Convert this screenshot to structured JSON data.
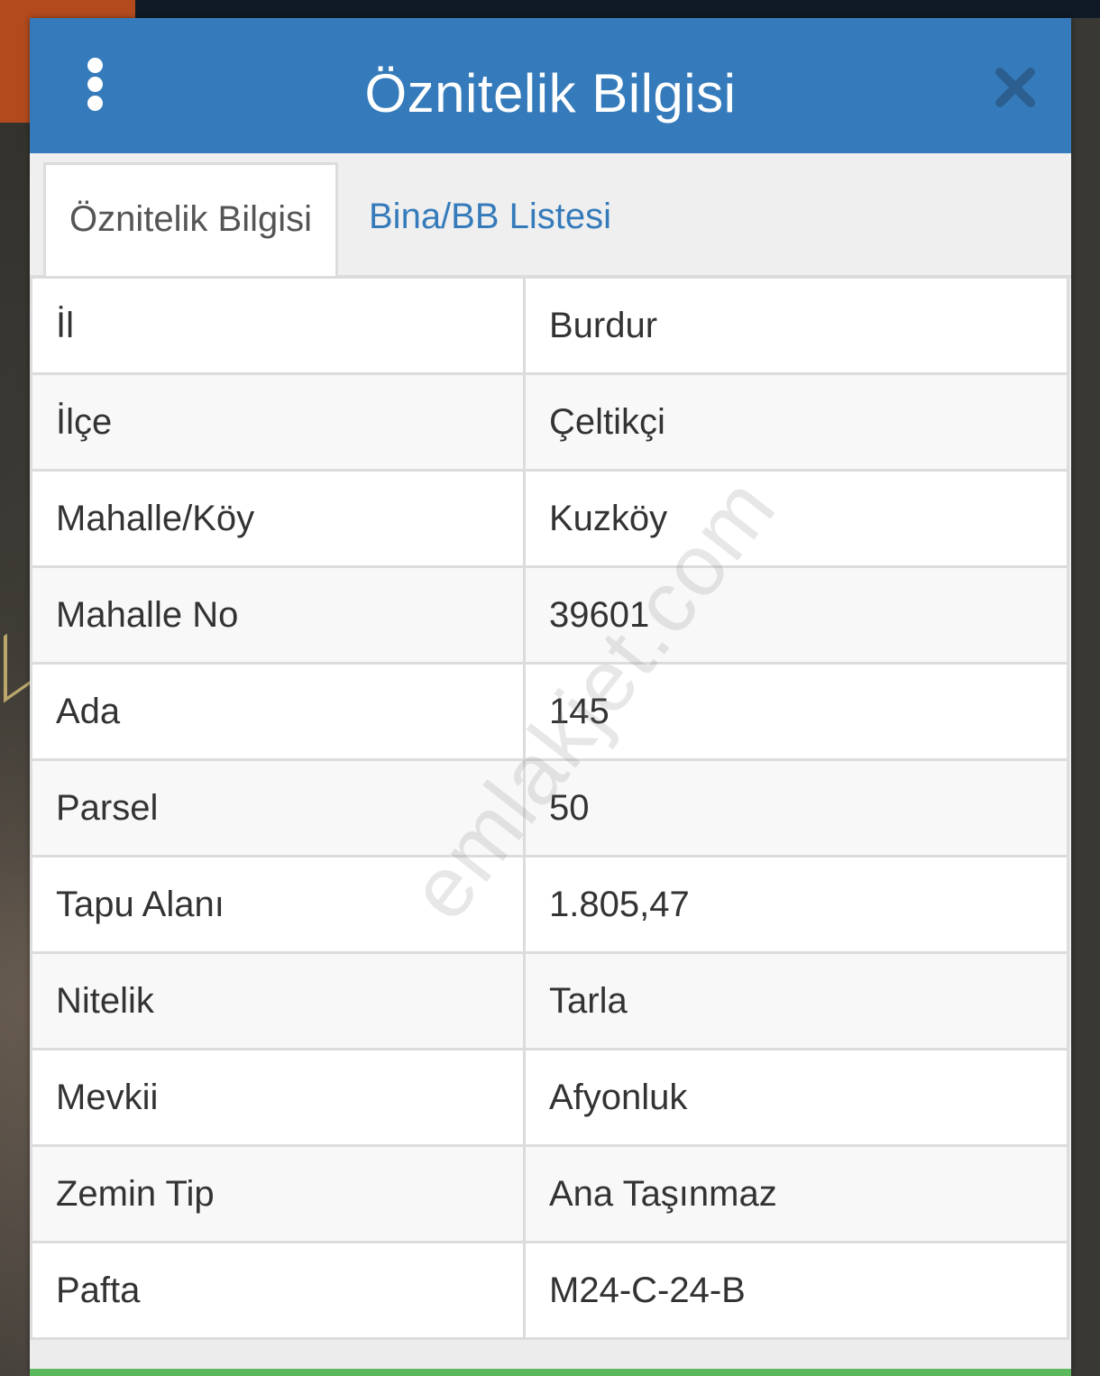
{
  "modal": {
    "title": "Öznitelik Bilgisi",
    "menu_icon": "vertical-dots-icon",
    "close_icon": "close-x-icon"
  },
  "tabs": [
    {
      "label": "Öznitelik Bilgisi",
      "active": true
    },
    {
      "label": "Bina/BB Listesi",
      "active": false
    }
  ],
  "attributes": [
    {
      "key": "İl",
      "value": "Burdur"
    },
    {
      "key": "İlçe",
      "value": "Çeltikçi"
    },
    {
      "key": "Mahalle/Köy",
      "value": "Kuzköy"
    },
    {
      "key": "Mahalle No",
      "value": "39601"
    },
    {
      "key": "Ada",
      "value": "145"
    },
    {
      "key": "Parsel",
      "value": "50"
    },
    {
      "key": "Tapu Alanı",
      "value": "1.805,47"
    },
    {
      "key": "Nitelik",
      "value": "Tarla"
    },
    {
      "key": "Mevkii",
      "value": "Afyonluk"
    },
    {
      "key": "Zemin Tip",
      "value": "Ana Taşınmaz"
    },
    {
      "key": "Pafta",
      "value": "M24-C-24-B"
    }
  ],
  "watermark": "emlakjet.com",
  "colors": {
    "header": "#357bbb",
    "tab_link": "#357bbb",
    "bottom_bar": "#5cb85c"
  }
}
